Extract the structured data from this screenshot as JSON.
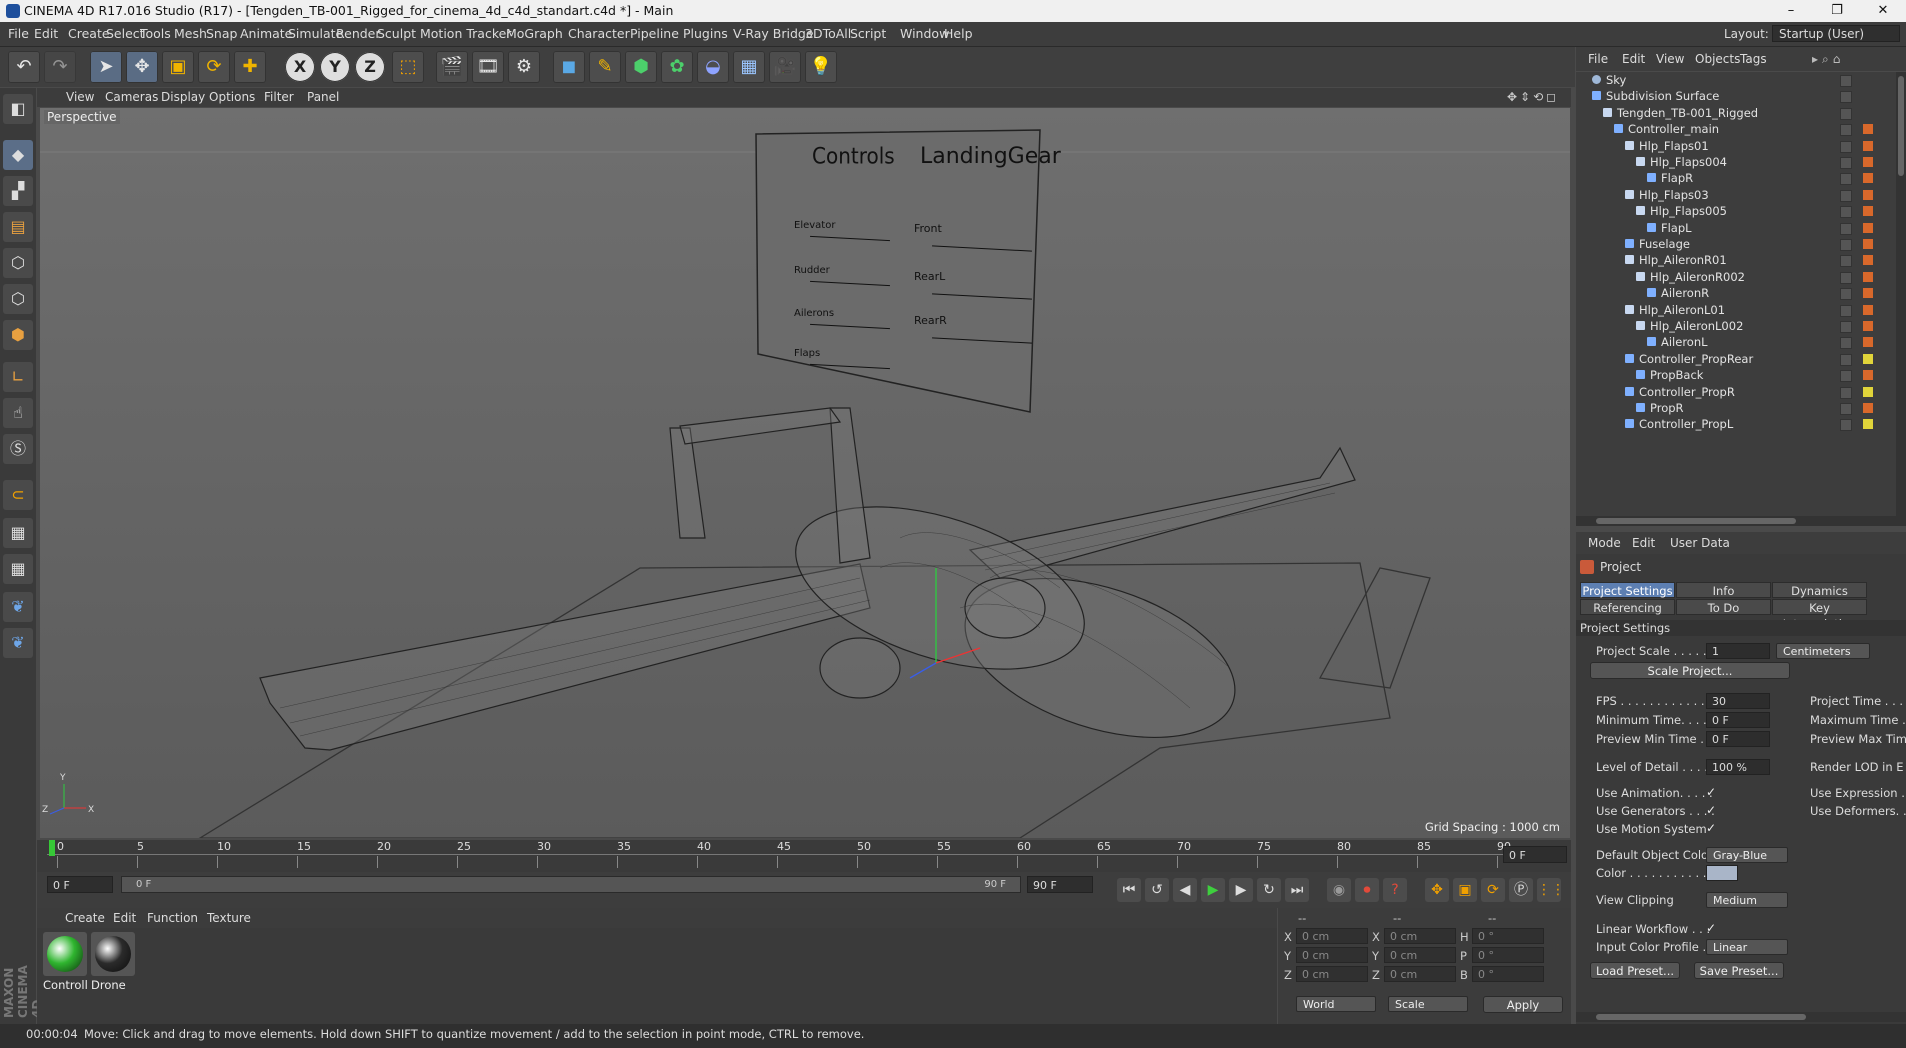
{
  "window": {
    "title": "CINEMA 4D R17.016 Studio (R17) - [Tengden_TB-001_Rigged_for_cinema_4d_c4d_standart.c4d *] - Main"
  },
  "menu": [
    "File",
    "Edit",
    "Create",
    "Select",
    "Tools",
    "Mesh",
    "Snap",
    "Animate",
    "Simulate",
    "Render",
    "Sculpt",
    "Motion Tracker",
    "MoGraph",
    "Character",
    "Pipeline",
    "Plugins",
    "V-Ray Bridge",
    "3DToAll",
    "Script",
    "Window",
    "Help"
  ],
  "layout": {
    "label": "Layout:",
    "value": "Startup (User)"
  },
  "viewport": {
    "menu": [
      "View",
      "Cameras",
      "Display",
      "Options",
      "Filter",
      "Panel"
    ],
    "label": "Perspective",
    "grid_spacing": "Grid Spacing : 1000 cm",
    "board": {
      "left_title": "Controls",
      "right_title": "LandingGear",
      "left_items": [
        "Elevator",
        "Rudder",
        "Ailerons",
        "Flaps"
      ],
      "right_items": [
        "Front",
        "RearL",
        "RearR"
      ]
    }
  },
  "timeline": {
    "ticks": [
      "0",
      "5",
      "10",
      "15",
      "20",
      "25",
      "30",
      "35",
      "40",
      "45",
      "50",
      "55",
      "60",
      "65",
      "70",
      "75",
      "80",
      "85",
      "90"
    ],
    "end_field": "0 F",
    "current": "0 F",
    "range_start": "0 F",
    "range_end": "90 F",
    "max": "90 F"
  },
  "materials": {
    "menu": [
      "Create",
      "Edit",
      "Function",
      "Texture"
    ],
    "items": [
      {
        "name": "Controll",
        "color": "#2fb52f"
      },
      {
        "name": "Drone",
        "color": "#2b2b2b"
      }
    ]
  },
  "coords": {
    "headers": [
      "--",
      "--",
      "--"
    ],
    "rows": [
      [
        "X",
        "0 cm",
        "X",
        "0 cm",
        "H",
        "0 °"
      ],
      [
        "Y",
        "0 cm",
        "Y",
        "0 cm",
        "P",
        "0 °"
      ],
      [
        "Z",
        "0 cm",
        "Z",
        "0 cm",
        "B",
        "0 °"
      ]
    ],
    "world": "World",
    "scale": "Scale",
    "apply": "Apply"
  },
  "status": {
    "time": "00:00:04",
    "message": "Move: Click and drag to move elements. Hold down SHIFT to quantize movement / add to the selection in point mode, CTRL to remove."
  },
  "objects": {
    "menu": [
      "File",
      "Edit",
      "View",
      "Objects",
      "Tags"
    ],
    "items": [
      {
        "name": "Sky",
        "indent": 0,
        "tag": ""
      },
      {
        "name": "Subdivision Surface",
        "indent": 0,
        "tag": ""
      },
      {
        "name": "Tengden_TB-001_Rigged",
        "indent": 1,
        "tag": ""
      },
      {
        "name": "Controller_main",
        "indent": 2,
        "tag": "#d8682b"
      },
      {
        "name": "Hlp_Flaps01",
        "indent": 3,
        "tag": "#d8682b"
      },
      {
        "name": "Hlp_Flaps004",
        "indent": 4,
        "tag": "#d8682b"
      },
      {
        "name": "FlapR",
        "indent": 5,
        "tag": "#d8682b"
      },
      {
        "name": "Hlp_Flaps03",
        "indent": 3,
        "tag": "#d8682b"
      },
      {
        "name": "Hlp_Flaps005",
        "indent": 4,
        "tag": "#d8682b"
      },
      {
        "name": "FlapL",
        "indent": 5,
        "tag": "#d8682b"
      },
      {
        "name": "Fuselage",
        "indent": 3,
        "tag": "#d8682b"
      },
      {
        "name": "Hlp_AileronR01",
        "indent": 3,
        "tag": "#d8682b"
      },
      {
        "name": "Hlp_AileronR002",
        "indent": 4,
        "tag": "#d8682b"
      },
      {
        "name": "AileronR",
        "indent": 5,
        "tag": "#d8682b"
      },
      {
        "name": "Hlp_AileronL01",
        "indent": 3,
        "tag": "#d8682b"
      },
      {
        "name": "Hlp_AileronL002",
        "indent": 4,
        "tag": "#d8682b"
      },
      {
        "name": "AileronL",
        "indent": 5,
        "tag": "#d8682b"
      },
      {
        "name": "Controller_PropRear",
        "indent": 3,
        "tag": "#e0d43a"
      },
      {
        "name": "PropBack",
        "indent": 4,
        "tag": "#d8682b"
      },
      {
        "name": "Controller_PropR",
        "indent": 3,
        "tag": "#e0d43a"
      },
      {
        "name": "PropR",
        "indent": 4,
        "tag": "#d8682b"
      },
      {
        "name": "Controller_PropL",
        "indent": 3,
        "tag": "#e0d43a"
      }
    ]
  },
  "attributes": {
    "menu": [
      "Mode",
      "Edit",
      "User Data"
    ],
    "header": "Project",
    "tabs": [
      [
        "Project Settings",
        "Info",
        "Dynamics"
      ],
      [
        "Referencing",
        "To Do",
        "Key Interpolation"
      ]
    ],
    "section": "Project Settings",
    "project_scale": {
      "label": "Project Scale . . . . . .",
      "value": "1",
      "unit": "Centimeters"
    },
    "scale_button": "Scale Project...",
    "fps": {
      "label": "FPS . . . . . . . . . . . . . . .",
      "value": "30"
    },
    "min_time": {
      "label": "Minimum Time. . . . . .",
      "value": "0 F"
    },
    "preview_min": {
      "label": "Preview Min Time . . .",
      "value": "0 F"
    },
    "right_labels": [
      "Project Time . . . .",
      "Maximum Time . .",
      "Preview Max Tim"
    ],
    "lod": {
      "label": "Level of Detail . . . . .",
      "value": "100 %",
      "right": "Render LOD in E"
    },
    "use_animation": "Use Animation. . . . .",
    "use_generators": "Use Generators . . . .",
    "use_motion": "Use Motion System",
    "use_expression": "Use Expression .",
    "use_deformers": "Use Deformers. .",
    "default_color": {
      "label": "Default Object Color",
      "value": "Gray-Blue"
    },
    "color_label": "Color . . . . . . . . . . . .",
    "view_clipping": {
      "label": "View Clipping",
      "value": "Medium"
    },
    "linear_workflow": "Linear Workflow . . .",
    "input_profile": {
      "label": "Input Color Profile .",
      "value": "Linear"
    },
    "load_preset": "Load Preset...",
    "save_preset": "Save Preset..."
  }
}
